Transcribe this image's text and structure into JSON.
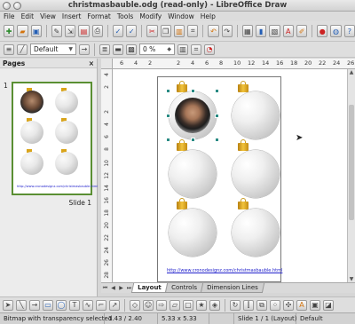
{
  "window": {
    "title": "christmasbauble.odg (read-only) - LibreOffice Draw"
  },
  "menu": [
    "File",
    "Edit",
    "View",
    "Insert",
    "Format",
    "Tools",
    "Modify",
    "Window",
    "Help"
  ],
  "toolbar": {
    "style_value": "Default",
    "transparency_value": "0 %"
  },
  "pages_panel": {
    "title": "Pages",
    "close_glyph": "×",
    "page_number": "1",
    "slide_label": "Slide 1"
  },
  "ruler": {
    "h_marks": [
      "6",
      "4",
      "2",
      "",
      "2",
      "4",
      "6",
      "8",
      "10",
      "12",
      "14",
      "16",
      "18",
      "20",
      "22",
      "24",
      "26"
    ],
    "v_marks": [
      "4",
      "2",
      "",
      "2",
      "4",
      "6",
      "8",
      "10",
      "12",
      "14",
      "16",
      "18",
      "20",
      "22",
      "24",
      "26",
      "28"
    ]
  },
  "document": {
    "url_text": "http://www.cronodesignz.com/christmasbauble.html"
  },
  "layout_tabs": [
    "Layout",
    "Controls",
    "Dimension Lines"
  ],
  "status": {
    "selection": "Bitmap with transparency selected",
    "position": "1.43 / 2.40",
    "size": "5.33 x 5.33",
    "slide": "Slide 1 / 1 (Layout)",
    "master": "Default"
  },
  "icons": [
    "new-icon",
    "open-icon",
    "save-icon",
    "export-icon",
    "pdf-icon",
    "print-icon",
    "spellcheck-icon",
    "cut-icon",
    "copy-icon",
    "paste-icon",
    "undo-icon",
    "redo-icon",
    "chart-icon",
    "navigator-icon",
    "help-icon"
  ]
}
